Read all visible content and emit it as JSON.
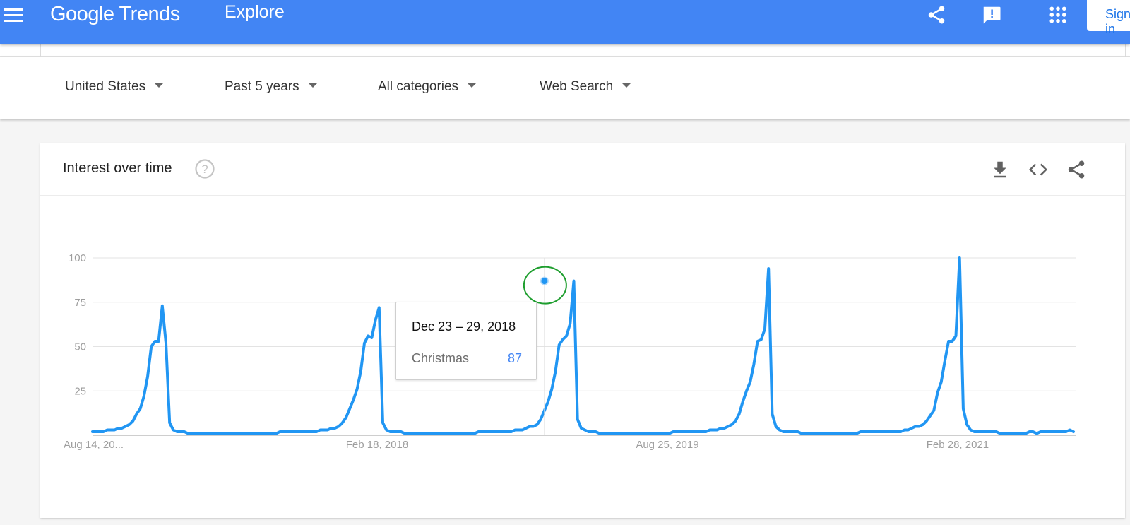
{
  "header": {
    "brand": "Google Trends",
    "page": "Explore",
    "sign_in_label": "Sign in",
    "icons": [
      "menu-icon",
      "share-icon",
      "feedback-icon",
      "apps-grid-icon"
    ]
  },
  "filters": [
    {
      "label": "United States"
    },
    {
      "label": "Past 5 years"
    },
    {
      "label": "All categories"
    },
    {
      "label": "Web Search"
    }
  ],
  "card": {
    "title": "Interest over time",
    "actions": [
      "download-icon",
      "embed-code-icon",
      "share-icon"
    ]
  },
  "tooltip": {
    "date": "Dec 23 – 29, 2018",
    "term": "Christmas",
    "value": "87"
  },
  "colors": {
    "brand_blue": "#4285f4",
    "series_blue": "#2196f3",
    "highlight_ring": "#1e9e2e"
  },
  "chart_data": {
    "type": "line",
    "title": "Interest over time",
    "xlabel": "",
    "ylabel": "",
    "ylim": [
      0,
      100
    ],
    "yticks": [
      25,
      50,
      75,
      100
    ],
    "x_tick_labels": [
      "Aug 14, 20...",
      "Feb 18, 2018",
      "Aug 25, 2019",
      "Feb 28, 2021"
    ],
    "x_tick_week_index": [
      0,
      79,
      158,
      237
    ],
    "grid": true,
    "legend": "none",
    "highlight": {
      "week_index": 123,
      "label": "Dec 23 – 29, 2018",
      "value": 87
    },
    "series": [
      {
        "name": "Christmas",
        "frequency": "weekly",
        "start": "Aug 14, 2016",
        "values": [
          2,
          2,
          2,
          2,
          3,
          3,
          3,
          4,
          4,
          5,
          6,
          8,
          12,
          15,
          22,
          33,
          50,
          53,
          53,
          73,
          52,
          7,
          3,
          2,
          2,
          2,
          1,
          1,
          1,
          1,
          1,
          1,
          1,
          1,
          1,
          1,
          1,
          1,
          1,
          1,
          1,
          1,
          1,
          1,
          1,
          1,
          1,
          1,
          1,
          1,
          1,
          2,
          2,
          2,
          2,
          2,
          2,
          2,
          2,
          2,
          2,
          2,
          3,
          3,
          3,
          4,
          4,
          5,
          7,
          10,
          15,
          20,
          26,
          36,
          52,
          56,
          55,
          65,
          72,
          7,
          3,
          2,
          2,
          2,
          2,
          1,
          1,
          1,
          1,
          1,
          1,
          1,
          1,
          1,
          1,
          1,
          1,
          1,
          1,
          1,
          1,
          1,
          1,
          1,
          1,
          2,
          2,
          2,
          2,
          2,
          2,
          2,
          2,
          2,
          2,
          3,
          3,
          3,
          4,
          5,
          5,
          6,
          9,
          14,
          19,
          26,
          36,
          51,
          54,
          56,
          63,
          87,
          9,
          4,
          3,
          2,
          2,
          2,
          1,
          1,
          1,
          1,
          1,
          1,
          1,
          1,
          1,
          1,
          1,
          1,
          1,
          1,
          1,
          1,
          1,
          1,
          1,
          1,
          2,
          2,
          2,
          2,
          2,
          2,
          2,
          2,
          2,
          2,
          3,
          3,
          3,
          4,
          4,
          5,
          6,
          8,
          12,
          19,
          25,
          30,
          40,
          53,
          54,
          60,
          94,
          12,
          5,
          3,
          2,
          2,
          2,
          2,
          2,
          1,
          1,
          1,
          1,
          1,
          1,
          1,
          1,
          1,
          1,
          1,
          1,
          1,
          1,
          1,
          1,
          2,
          2,
          2,
          2,
          2,
          2,
          2,
          2,
          2,
          2,
          2,
          2,
          3,
          3,
          4,
          5,
          5,
          6,
          8,
          11,
          14,
          24,
          30,
          42,
          53,
          53,
          56,
          100,
          15,
          6,
          3,
          2,
          2,
          2,
          2,
          2,
          2,
          2,
          1,
          1,
          1,
          1,
          1,
          1,
          1,
          1,
          2,
          2,
          1,
          2,
          2,
          2,
          2,
          2,
          2,
          2,
          2,
          3,
          2
        ]
      }
    ]
  }
}
